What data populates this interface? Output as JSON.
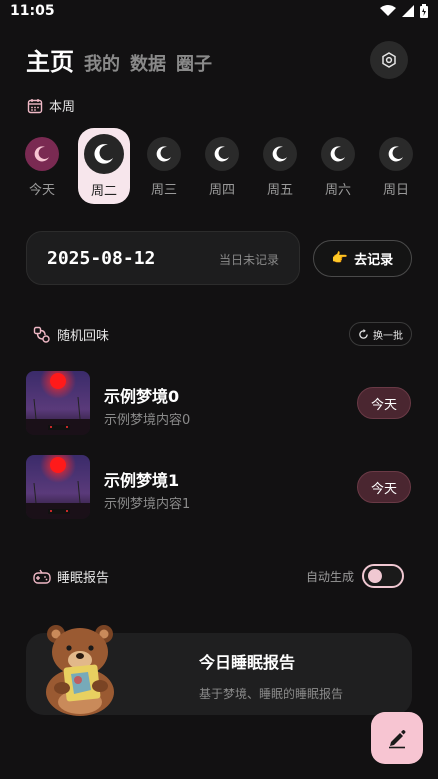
{
  "status": {
    "time": "11:05"
  },
  "header": {
    "tabs": [
      {
        "label": "主页"
      },
      {
        "label": "我的"
      },
      {
        "label": "数据"
      },
      {
        "label": "圈子"
      }
    ],
    "settings_icon": "settings-icon"
  },
  "week": {
    "label": "本周",
    "days": [
      {
        "label": "今天"
      },
      {
        "label": "周二"
      },
      {
        "label": "周三"
      },
      {
        "label": "周四"
      },
      {
        "label": "周五"
      },
      {
        "label": "周六"
      },
      {
        "label": "周日"
      }
    ]
  },
  "record": {
    "date": "2025-08-12",
    "status": "当日未记录",
    "button_label": "去记录",
    "button_emoji": "👉"
  },
  "recall": {
    "title": "随机回味",
    "refresh_label": "换一批",
    "items": [
      {
        "title": "示例梦境0",
        "content": "示例梦境内容0",
        "badge": "今天"
      },
      {
        "title": "示例梦境1",
        "content": "示例梦境内容1",
        "badge": "今天"
      }
    ]
  },
  "sleep_report": {
    "title": "睡眠报告",
    "auto_label": "自动生成",
    "auto_enabled": false,
    "card_title": "今日睡眠报告",
    "card_subtitle": "基于梦境、睡眠的睡眠报告"
  },
  "colors": {
    "background": "#121112",
    "accent_pink": "#f7c5d2",
    "today_moon": "#7a2a52",
    "badge_bg": "#4a2630"
  }
}
